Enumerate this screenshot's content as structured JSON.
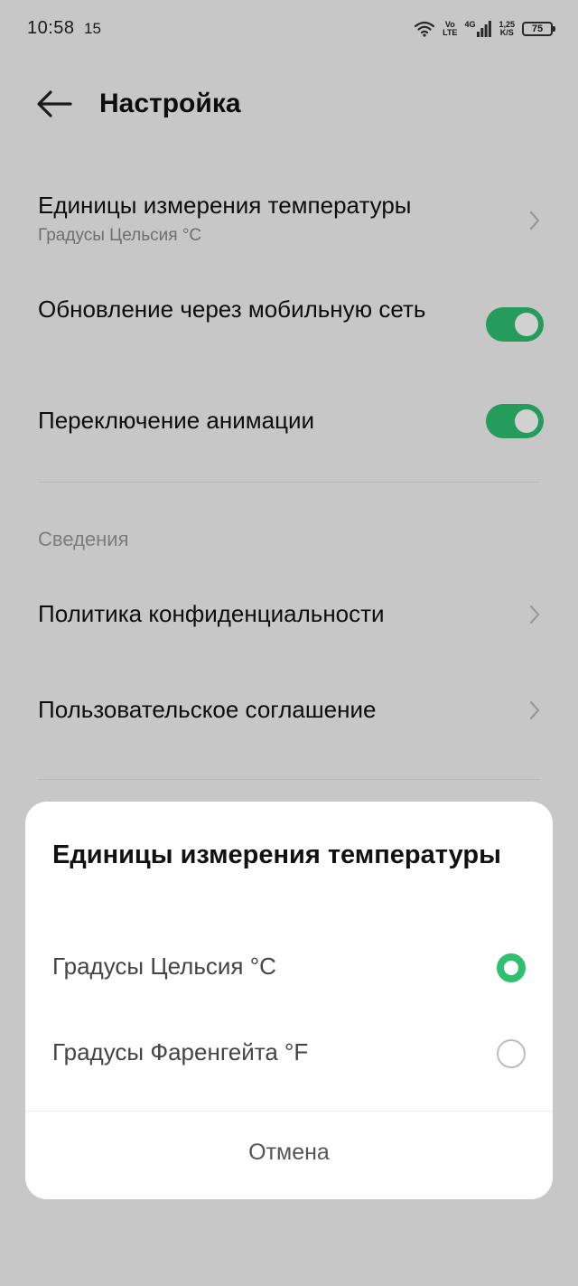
{
  "status_bar": {
    "time": "10:58",
    "temperature": "15",
    "volte_top": "Vo",
    "volte_bottom": "LTE",
    "network": "4G",
    "speed_top": "1,25",
    "speed_bottom": "K/S",
    "battery": "75"
  },
  "header": {
    "title": "Настройка"
  },
  "settings": {
    "temperature_units": {
      "title": "Единицы измерения температуры",
      "value": "Градусы Цельсия °C"
    },
    "mobile_update": {
      "title": "Обновление через мобильную сеть",
      "enabled": true
    },
    "animation_toggle": {
      "title": "Переключение анимации",
      "enabled": true
    },
    "section_info": "Сведения",
    "privacy_policy": "Политика конфиденциальности",
    "user_agreement": "Пользовательское соглашение"
  },
  "dialog": {
    "title": "Единицы измерения температуры",
    "options": [
      {
        "label": "Градусы Цельсия °C",
        "selected": true
      },
      {
        "label": "Градусы Фаренгейта °F",
        "selected": false
      }
    ],
    "cancel_label": "Отмена"
  },
  "colors": {
    "accent": "#2fbf71",
    "background": "#f3f3f3"
  }
}
